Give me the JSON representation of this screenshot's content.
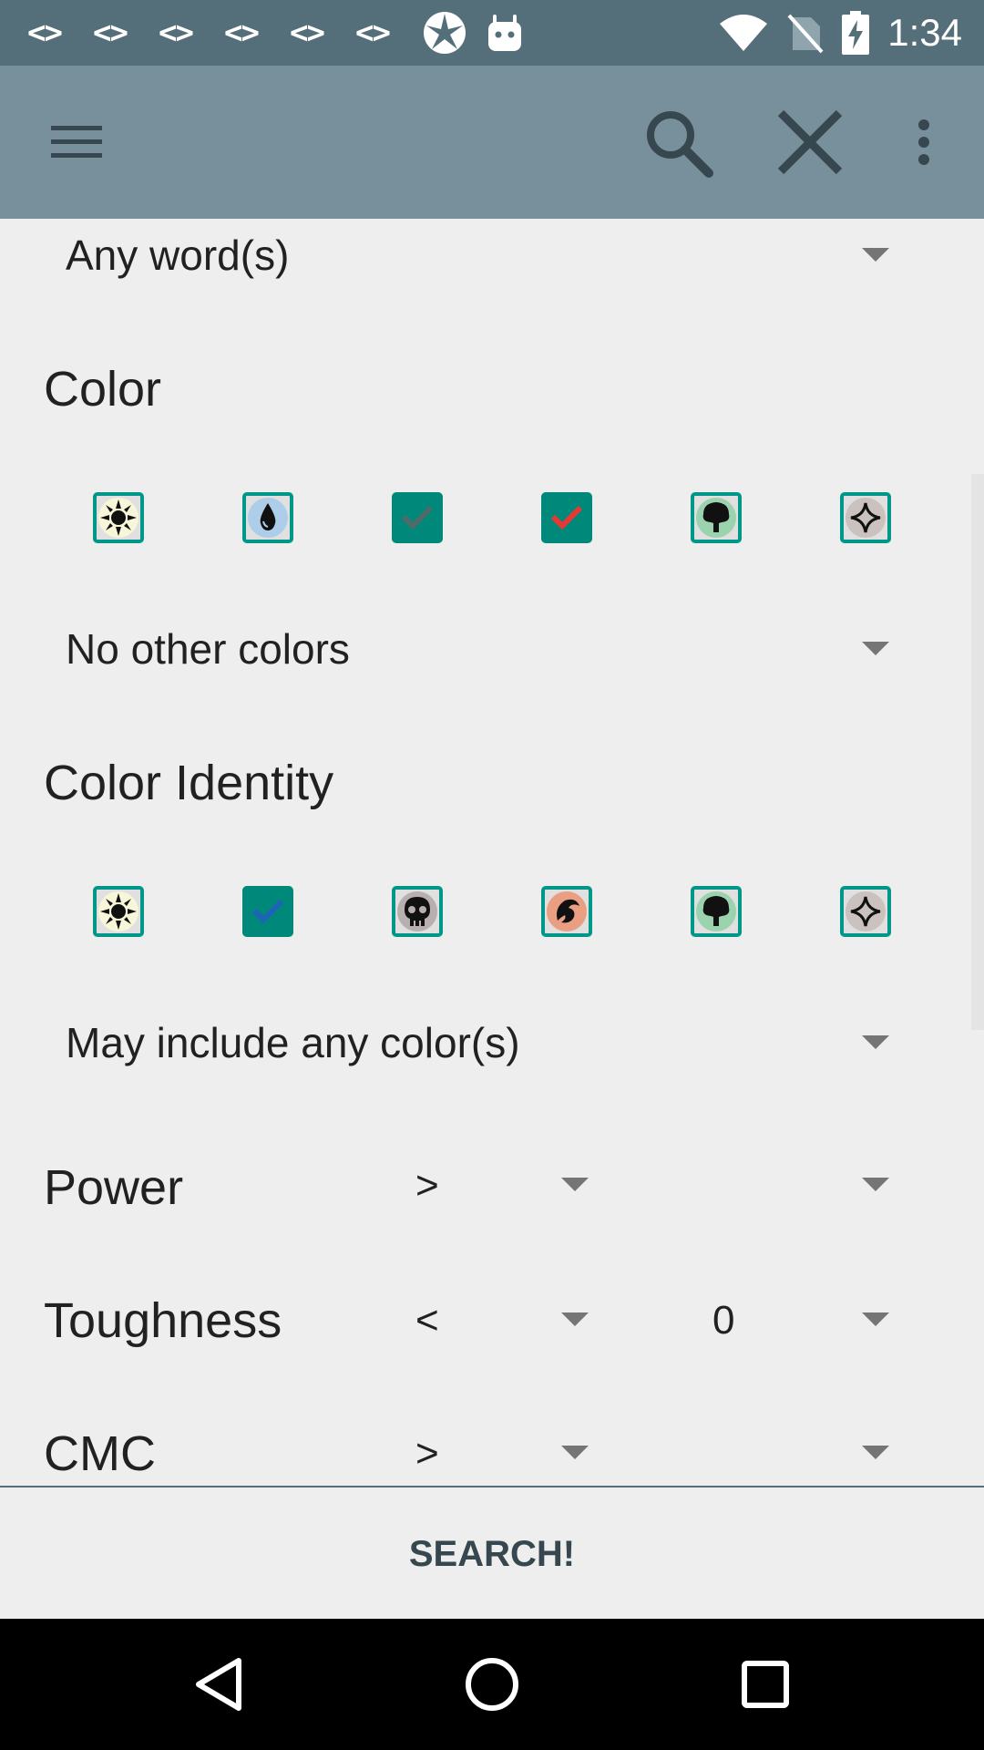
{
  "status_bar": {
    "code_glyph": "<>",
    "time": "1:34",
    "icons": [
      "code-icon",
      "code-icon",
      "code-icon",
      "code-icon",
      "code-icon",
      "code-icon",
      "mtg-icon",
      "android-icon",
      "wifi-icon",
      "no-sim-icon",
      "battery-charging-icon"
    ]
  },
  "toolbar": {
    "icons": [
      "menu-icon",
      "search-icon",
      "close-icon",
      "more-vert-icon"
    ]
  },
  "text_mode": {
    "selected": "Any word(s)"
  },
  "color": {
    "title": "Color",
    "boxes": [
      {
        "name": "white-mana",
        "checked": false
      },
      {
        "name": "blue-mana",
        "checked": false
      },
      {
        "name": "black-mana",
        "checked": true
      },
      {
        "name": "red-mana",
        "checked": true
      },
      {
        "name": "green-mana",
        "checked": false
      },
      {
        "name": "colorless-mana",
        "checked": false
      }
    ],
    "mode": "No other colors"
  },
  "color_identity": {
    "title": "Color Identity",
    "boxes": [
      {
        "name": "white-mana",
        "checked": false
      },
      {
        "name": "blue-mana",
        "checked": true
      },
      {
        "name": "black-mana",
        "checked": false
      },
      {
        "name": "red-mana",
        "checked": false
      },
      {
        "name": "green-mana",
        "checked": false
      },
      {
        "name": "colorless-mana",
        "checked": false
      }
    ],
    "mode": "May include any color(s)"
  },
  "power": {
    "label": "Power",
    "operator": ">",
    "value": ""
  },
  "toughness": {
    "label": "Toughness",
    "operator": "<",
    "value": "0"
  },
  "cmc": {
    "label": "CMC",
    "operator": ">",
    "value": ""
  },
  "search_button": "SEARCH!",
  "colors": {
    "status_bar": "#546e7a",
    "toolbar": "#78909c",
    "accent": "#009688",
    "check_black": "#4e6b67",
    "check_red": "#e53935",
    "check_blue": "#1e63b8"
  }
}
